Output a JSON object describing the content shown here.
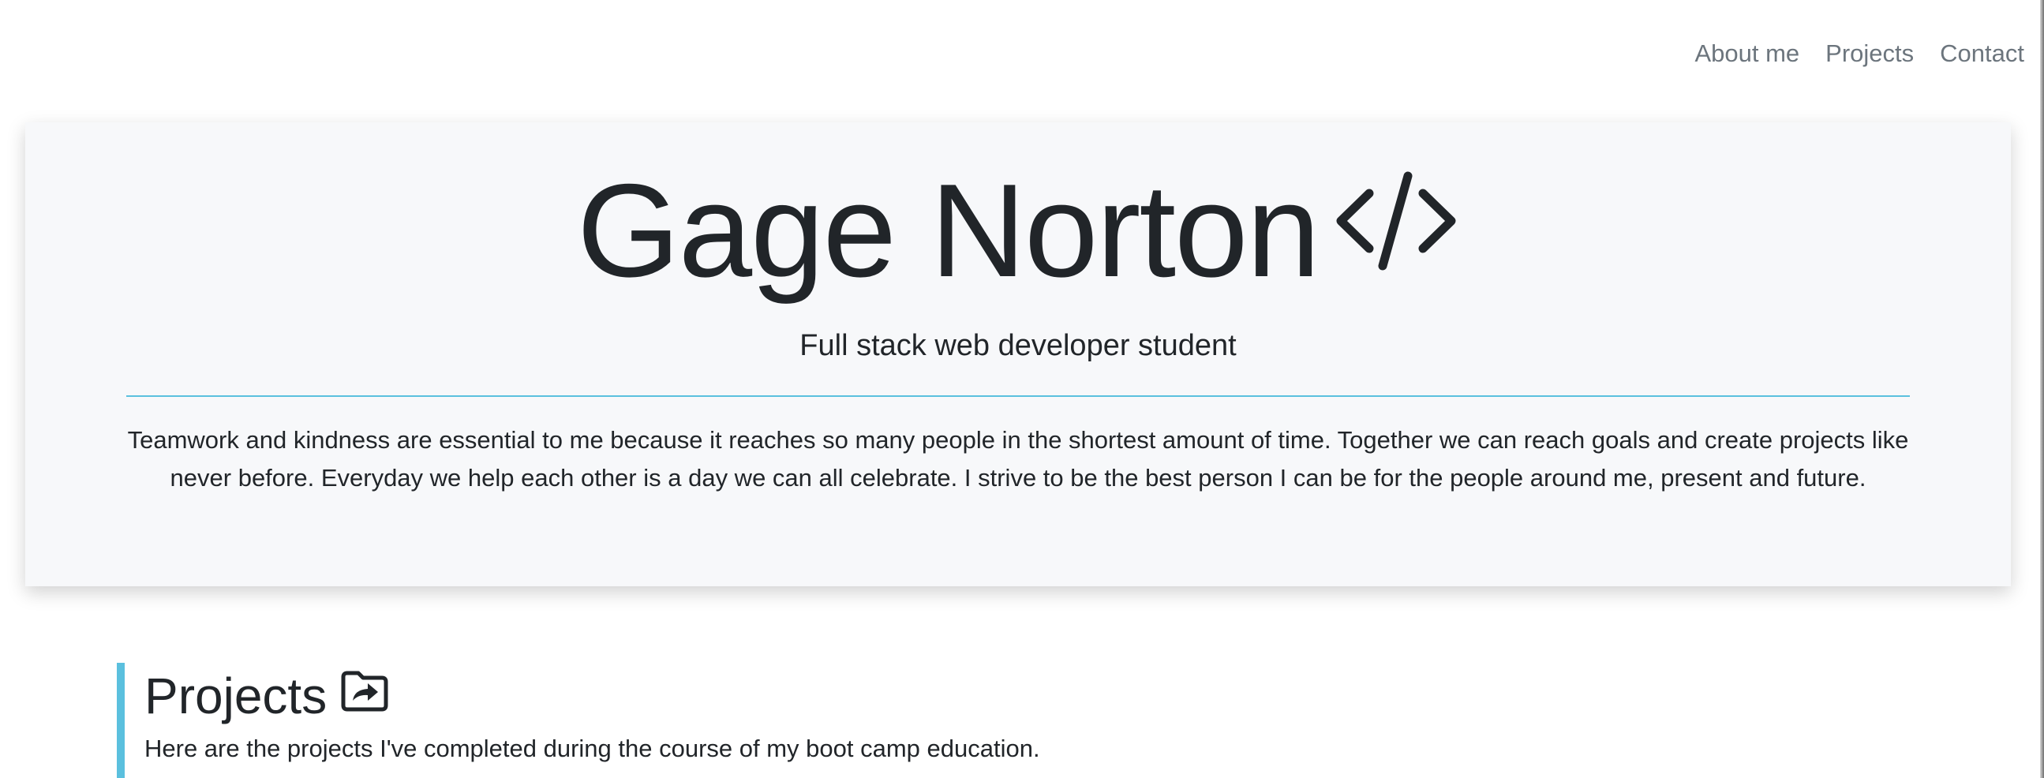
{
  "nav": {
    "items": [
      {
        "label": "About me"
      },
      {
        "label": "Projects"
      },
      {
        "label": "Contact"
      }
    ]
  },
  "hero": {
    "title": "Gage Norton",
    "title_icon": "code-icon",
    "subtitle": "Full stack web developer student",
    "bio": "Teamwork and kindness are essential to me because it reaches so many people in the shortest amount of time. Together we can reach goals and create projects like never before. Everyday we help each other is a day we can all celebrate. I strive to be the best person I can be for the people around me, present and future."
  },
  "projects": {
    "title": "Projects",
    "title_icon": "folder-share-icon",
    "description": "Here are the projects I've completed during the course of my boot camp education."
  },
  "colors": {
    "accent": "#5bc0de",
    "nav_text": "#6c757d",
    "text": "#212529",
    "hero_bg": "#f7f8fa"
  }
}
